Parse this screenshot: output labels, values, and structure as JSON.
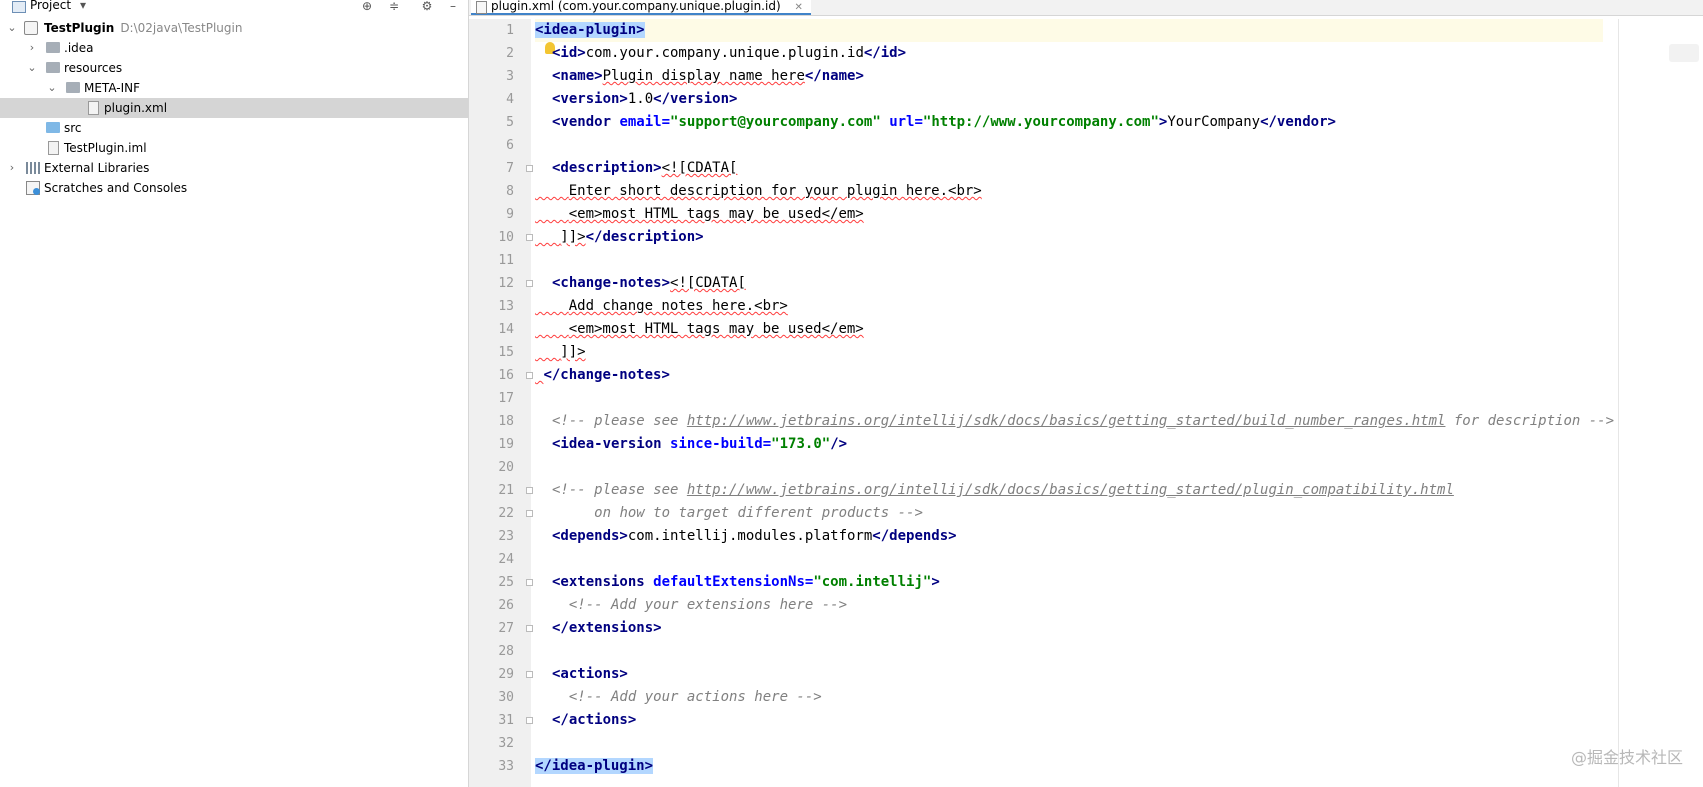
{
  "project_panel": {
    "title": "Project",
    "dropdown_glyph": "▾",
    "icons": [
      "locate-icon",
      "collapse-all-icon",
      "gear-icon",
      "hide-icon"
    ],
    "tree": [
      {
        "label": "TestPlugin",
        "path": "D:\\02java\\TestPlugin",
        "depth": 0,
        "expanded": true,
        "icon": "module-icon",
        "bold": true
      },
      {
        "label": ".idea",
        "depth": 1,
        "expanded": false,
        "icon": "folder-icon"
      },
      {
        "label": "resources",
        "depth": 1,
        "expanded": true,
        "icon": "resources-folder-icon"
      },
      {
        "label": "META-INF",
        "depth": 2,
        "expanded": true,
        "icon": "folder-icon"
      },
      {
        "label": "plugin.xml",
        "depth": 3,
        "icon": "xml-file-icon",
        "selected": true
      },
      {
        "label": "src",
        "depth": 1,
        "icon": "source-folder-icon"
      },
      {
        "label": "TestPlugin.iml",
        "depth": 1,
        "icon": "iml-file-icon"
      },
      {
        "label": "External Libraries",
        "depth": 0,
        "expanded": false,
        "icon": "libraries-icon"
      },
      {
        "label": "Scratches and Consoles",
        "depth": 0,
        "icon": "scratches-icon"
      }
    ]
  },
  "editor": {
    "tab_label": "plugin.xml (com.your.company.unique.plugin.id)",
    "tab_close": "✕",
    "line_numbers": [
      "1",
      "2",
      "3",
      "4",
      "5",
      "6",
      "7",
      "8",
      "9",
      "10",
      "11",
      "12",
      "13",
      "14",
      "15",
      "16",
      "17",
      "18",
      "19",
      "20",
      "21",
      "22",
      "23",
      "24",
      "25",
      "26",
      "27",
      "28",
      "29",
      "30",
      "31",
      "32",
      "33"
    ],
    "code": {
      "l1_open": "<idea-plugin>",
      "l2_open": "<id>",
      "l2_text": "com.your.company.unique.plugin.id",
      "l2_close": "</id>",
      "l3_open": "<name>",
      "l3_text": "Plugin display name here",
      "l3_close": "</name>",
      "l4_open": "<version>",
      "l4_text": "1.0",
      "l4_close": "</version>",
      "l5_open": "<vendor",
      "l5_attr1": "email=",
      "l5_val1": "\"support@yourcompany.com\"",
      "l5_attr2": "url=",
      "l5_val2": "\"http://www.yourcompany.com\"",
      "l5_gt": ">",
      "l5_text": "YourCompany",
      "l5_close": "</vendor>",
      "l7_open": "<description>",
      "l7_cdata": "<![CDATA[",
      "l8_text": "Enter short description for your plugin here.<br>",
      "l9_text": "<em>most HTML tags may be used</em>",
      "l10_cdata": "]]>",
      "l10_close": "</description>",
      "l12_open": "<change-notes>",
      "l12_cdata": "<![CDATA[",
      "l13_text": "Add change notes here.<br>",
      "l14_text": "<em>most HTML tags may be used</em>",
      "l15_cdata": "]]>",
      "l16_close": "</change-notes>",
      "l18_c1": "<!-- please see ",
      "l18_url": "http://www.jetbrains.org/intellij/sdk/docs/basics/getting_started/build_number_ranges.html",
      "l18_c2": " for description -->",
      "l19_open": "<idea-version",
      "l19_attr": "since-build=",
      "l19_val": "\"173.0\"",
      "l19_close": "/>",
      "l21_c1": "<!-- please see ",
      "l21_url": "http://www.jetbrains.org/intellij/sdk/docs/basics/getting_started/plugin_compatibility.html",
      "l22_c": "on how to target different products -->",
      "l23_open": "<depends>",
      "l23_text": "com.intellij.modules.platform",
      "l23_close": "</depends>",
      "l25_open": "<extensions",
      "l25_attr": "defaultExtensionNs=",
      "l25_val": "\"com.intellij\"",
      "l25_gt": ">",
      "l26_c": "<!-- Add your extensions here -->",
      "l27_close": "</extensions>",
      "l29_open": "<actions>",
      "l30_c": "<!-- Add your actions here -->",
      "l31_close": "</actions>",
      "l33_close": "</idea-plugin>"
    }
  },
  "watermark": "@掘金技术社区"
}
